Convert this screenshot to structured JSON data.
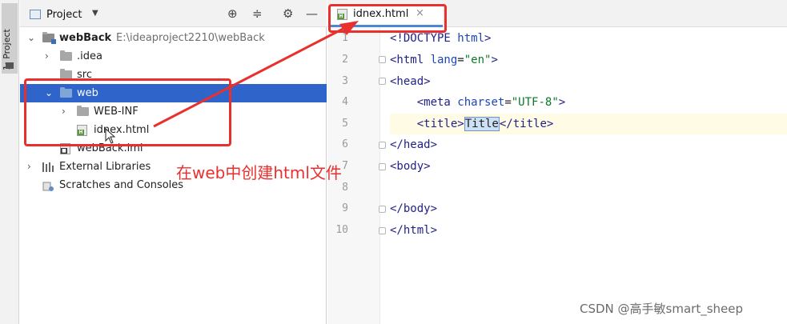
{
  "sidebar": {
    "tab_label": "1: Project"
  },
  "project": {
    "title": "Project",
    "tree": {
      "root": {
        "name": "webBack",
        "path": "E:\\ideaproject2210\\webBack"
      },
      "idea": ".idea",
      "src": "src",
      "web": "web",
      "webinf": "WEB-INF",
      "idnex": "idnex.html",
      "iml": "webBack.iml",
      "ext_libs": "External Libraries",
      "scratches": "Scratches and Consoles"
    }
  },
  "annotation": {
    "text": "在web中创建html文件"
  },
  "editor": {
    "tab_label": "idnex.html",
    "line_numbers": [
      "1",
      "2",
      "3",
      "4",
      "5",
      "6",
      "7",
      "8",
      "9",
      "10"
    ],
    "tokens": {
      "l1a": "<!DOCTYPE",
      "l1b": " html",
      "l1c": ">",
      "l2a": "<html ",
      "l2b": "lang",
      "l2c": "=",
      "l2d": "\"en\"",
      "l2e": ">",
      "l3": "<head>",
      "l4a": "    <meta ",
      "l4b": "charset",
      "l4c": "=",
      "l4d": "\"UTF-8\"",
      "l4e": ">",
      "l5a": "    <title>",
      "l5b": "Title",
      "l5c": "</title>",
      "l6": "</head>",
      "l7": "<body>",
      "l9": "</body>",
      "l10": "</html>"
    }
  },
  "watermark": "CSDN @高手敏smart_sheep",
  "colors": {
    "annotation": "#e8312f",
    "selection": "#2f65ca",
    "tab_underline": "#4a88d6"
  }
}
